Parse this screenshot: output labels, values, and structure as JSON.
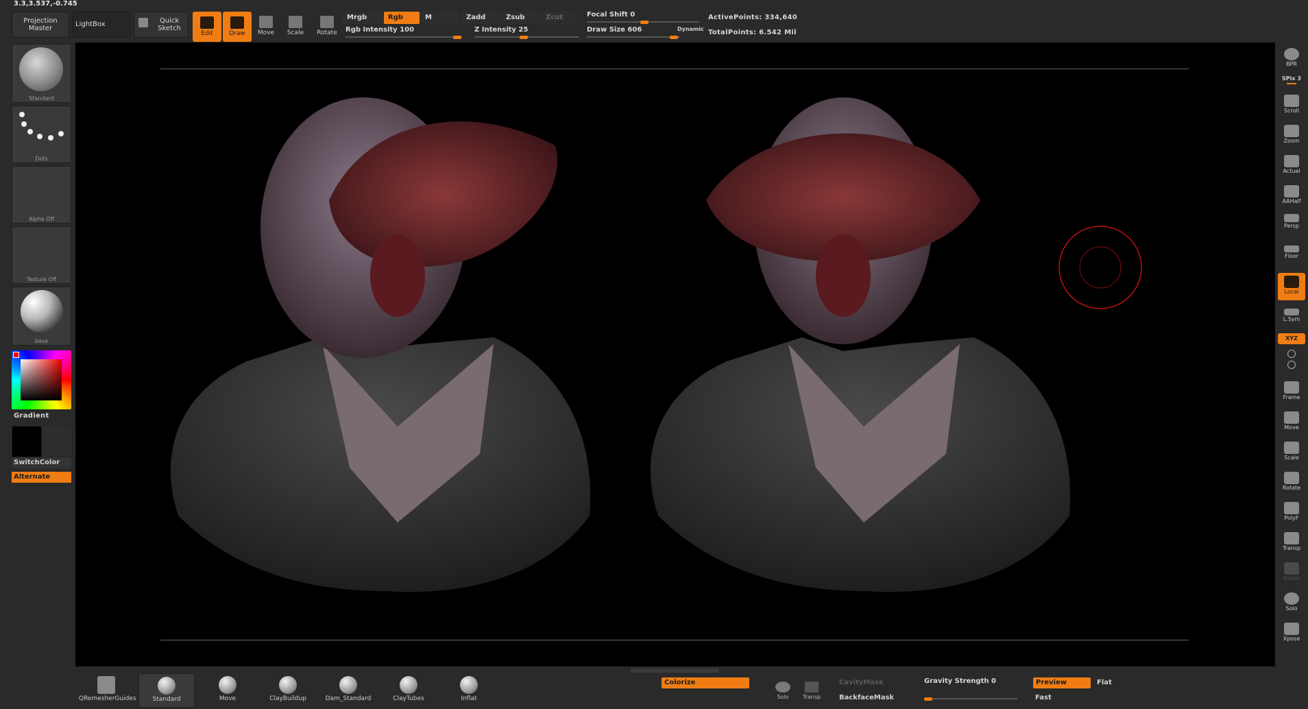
{
  "coords": "3.3,3.537,-0.745",
  "top": {
    "projection_master": [
      "Projection",
      "Master"
    ],
    "lightbox": "LightBox",
    "quick_sketch": [
      "Quick",
      "Sketch"
    ],
    "tools": [
      {
        "label": "Edit",
        "icon": "edit-icon",
        "on": true
      },
      {
        "label": "Draw",
        "icon": "draw-icon",
        "on": true
      },
      {
        "label": "Move",
        "icon": "move-icon",
        "on": false
      },
      {
        "label": "Scale",
        "icon": "scale-icon",
        "on": false
      },
      {
        "label": "Rotate",
        "icon": "rotate-icon",
        "on": false
      }
    ],
    "mrgb": "Mrgb",
    "rgb": "Rgb",
    "m": "M",
    "zadd": "Zadd",
    "zsub": "Zsub",
    "zcut": "Zcut",
    "rgb_intensity": "Rgb  Intensity 100",
    "z_intensity": "Z  Intensity 25",
    "focal_shift": "Focal  Shift 0",
    "draw_size": "Draw  Size 606",
    "dynamic": "Dynamic",
    "active_points": "ActivePoints: 334,640",
    "total_points": "TotalPoints: 6.542  Mil"
  },
  "left": {
    "brush": "Standard",
    "stroke": "Dots",
    "alpha": "Alpha  Off",
    "texture": "Texture  Off",
    "material": "base",
    "gradient": "Gradient",
    "switch_color": "SwitchColor",
    "alternate": "Alternate"
  },
  "right": [
    {
      "label": "BPR",
      "icon": "bpr-icon"
    },
    {
      "label": "SPix 3",
      "icon": ""
    },
    {
      "label": "Scroll",
      "icon": "scroll-hand-icon"
    },
    {
      "label": "Zoom",
      "icon": "zoom-icon"
    },
    {
      "label": "Actual",
      "icon": "actual-icon"
    },
    {
      "label": "AAHalf",
      "icon": "aahalf-icon"
    },
    {
      "label": "Persp",
      "icon": "persp-icon"
    },
    {
      "label": "Floor",
      "icon": "floor-icon"
    },
    {
      "label": "Local",
      "icon": "local-icon"
    },
    {
      "label": "L.Sym",
      "icon": "lsym-icon"
    },
    {
      "label": "XYZ",
      "icon": "xyz-icon"
    },
    {
      "label": "Frame",
      "icon": "frame-icon"
    },
    {
      "label": "Move",
      "icon": "move-hand-icon"
    },
    {
      "label": "Scale",
      "icon": "scale-icon"
    },
    {
      "label": "Rotate",
      "icon": "rotate-icon"
    },
    {
      "label": "PolyF",
      "icon": "polyf-icon"
    },
    {
      "label": "Transp",
      "icon": "transp-icon"
    },
    {
      "label": "Ghost",
      "icon": "ghost-icon"
    },
    {
      "label": "Solo",
      "icon": "solo-icon"
    },
    {
      "label": "Xpose",
      "icon": "xpose-icon"
    }
  ],
  "bottom": {
    "brushes": [
      "QRemesherGuides",
      "Standard",
      "Move",
      "ClayBuildup",
      "Dam_Standard",
      "ClayTubes",
      "Inflat"
    ],
    "colorize": "Colorize",
    "solo": "Solo",
    "transp": "Transp",
    "cavity_mask": "CavityMask",
    "backface_mask": "BackfaceMask",
    "gravity": "Gravity  Strength 0",
    "preview": "Preview",
    "flat": "Flat",
    "fast": "Fast"
  },
  "colors": {
    "accent": "#f07d13",
    "bg": "#2a2a2a",
    "canvas": "#000000"
  }
}
